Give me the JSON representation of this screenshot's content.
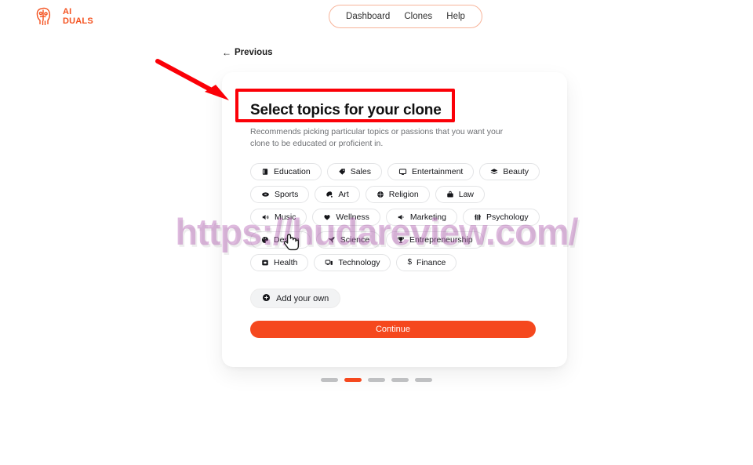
{
  "header": {
    "logo": {
      "text_line1": "AI",
      "text_line2": "DUALS",
      "icon": "head-profile-icon",
      "color": "#f4511e"
    },
    "nav": [
      {
        "label": "Dashboard",
        "name": "nav-item-dashboard"
      },
      {
        "label": "Clones",
        "name": "nav-item-clones"
      },
      {
        "label": "Help",
        "name": "nav-item-help"
      }
    ]
  },
  "previous": {
    "arrow": "←",
    "label": "Previous"
  },
  "card": {
    "title": "Select topics for your clone",
    "subtitle": "Recommends picking particular topics or passions that you want your clone to be educated or proficient in.",
    "chip_rows": [
      [
        {
          "label": "Education",
          "icon": "book-icon",
          "glyph": "▤"
        },
        {
          "label": "Sales",
          "icon": "tag-icon",
          "glyph": "🏷"
        },
        {
          "label": "Entertainment",
          "icon": "monitor-icon",
          "glyph": "🖵"
        },
        {
          "label": "Beauty",
          "icon": "layers-icon",
          "glyph": "≋"
        }
      ],
      [
        {
          "label": "Sports",
          "icon": "football-icon",
          "glyph": "🏈"
        },
        {
          "label": "Art",
          "icon": "paint-palette-icon",
          "glyph": "🎨"
        },
        {
          "label": "Religion",
          "icon": "globe-icon",
          "glyph": "🌐"
        },
        {
          "label": "Law",
          "icon": "briefcase-icon",
          "glyph": "💼"
        }
      ],
      [
        {
          "label": "Music",
          "icon": "speaker-icon",
          "glyph": "🔊"
        },
        {
          "label": "Wellness",
          "icon": "heart-icon",
          "glyph": "♥"
        },
        {
          "label": "Marketing",
          "icon": "megaphone-icon",
          "glyph": "📢"
        },
        {
          "label": "Psychology",
          "icon": "brain-icon",
          "glyph": "🧠"
        }
      ],
      [
        {
          "label": "Design",
          "icon": "palette-icon",
          "glyph": "🎨"
        },
        {
          "label": "Science",
          "icon": "rocket-icon",
          "glyph": "✈"
        },
        {
          "label": "Entrepreneurship",
          "icon": "trophy-icon",
          "glyph": "🏆"
        }
      ],
      [
        {
          "label": "Health",
          "icon": "health-monitor-icon",
          "glyph": "🩺"
        },
        {
          "label": "Technology",
          "icon": "devices-icon",
          "glyph": "💻"
        },
        {
          "label": "Finance",
          "icon": "dollar-icon",
          "glyph": "$"
        }
      ]
    ],
    "add_own": {
      "label": "Add your own",
      "icon": "plus-circle-icon"
    },
    "continue": {
      "label": "Continue",
      "color": "#f5481e"
    }
  },
  "pager": {
    "total": 5,
    "active_index": 1,
    "active_color": "#f5481e",
    "inactive_color": "#bfc0c2"
  },
  "annotations": {
    "box_color": "#fb0007",
    "arrow_color": "#fb0007",
    "watermark": "https://hudareview.com/"
  }
}
